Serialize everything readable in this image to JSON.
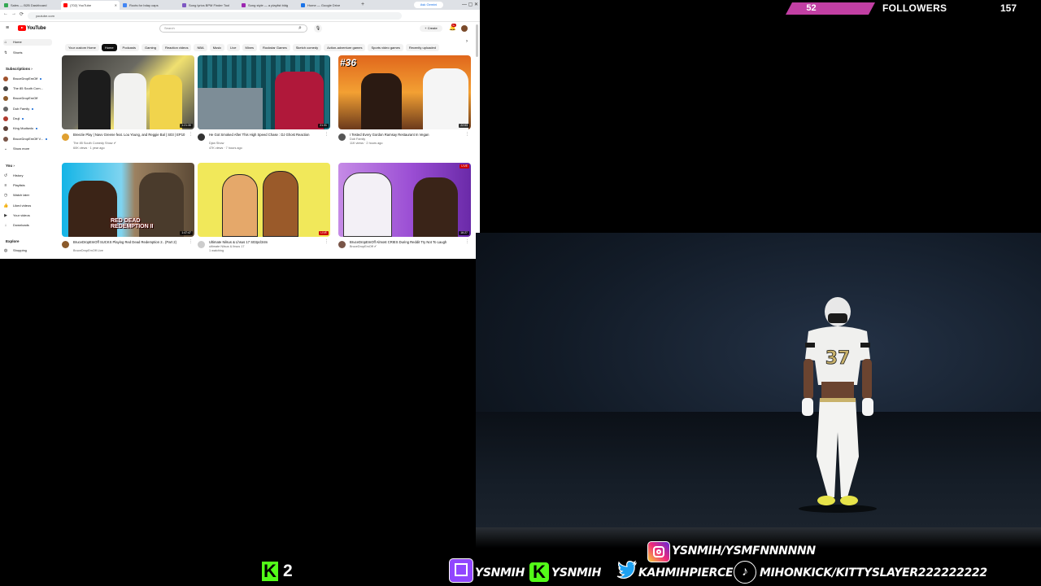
{
  "browser": {
    "tabs": [
      {
        "label": "Sales — B2B Dashboard",
        "color": "#34a853"
      },
      {
        "label": "(702) YouTube",
        "color": "#ff0000"
      },
      {
        "label": "Roots for bday caps",
        "color": "#4285f4"
      },
      {
        "label": "Song lyrics BPM Finder Tool",
        "color": "#7e57c2"
      },
      {
        "label": "Song style — a playlist bldg",
        "color": "#9c27b0"
      },
      {
        "label": "Home — Google Drive",
        "color": "#1a73e8"
      }
    ],
    "new_tab": "+",
    "gemini_label": "Ask Gemini",
    "window_controls": "—  ▢  ✕",
    "url": "youtube.com",
    "nav": {
      "back": "←",
      "forward": "→",
      "reload": "⟳"
    }
  },
  "youtube": {
    "logo_text": "YouTube",
    "search_placeholder": "Search",
    "create_label": "+ Create",
    "notification_count": "9+",
    "sidebar": {
      "main": [
        {
          "label": "Home",
          "icon": "⌂"
        },
        {
          "label": "Shorts",
          "icon": "↯"
        }
      ],
      "subscriptions_title": "Subscriptions ›",
      "subscriptions": [
        {
          "label": "BruceDropEmOff",
          "color": "#a0522d"
        },
        {
          "label": "The 85 South Com...",
          "color": "#444"
        },
        {
          "label": "BruceDropEmOff",
          "color": "#8b5a2b"
        },
        {
          "label": "Dub Family",
          "color": "#666"
        },
        {
          "label": "Druji",
          "color": "#b03a2e"
        },
        {
          "label": "King Mudiwdo",
          "color": "#5d4037"
        },
        {
          "label": "BruceDropEmOff V...",
          "color": "#795548"
        },
        {
          "label": "Show more",
          "color": "#ffffff"
        }
      ],
      "you_title": "You ›",
      "you": [
        {
          "label": "History",
          "icon": "↺"
        },
        {
          "label": "Playlists",
          "icon": "≡"
        },
        {
          "label": "Watch later",
          "icon": "◷"
        },
        {
          "label": "Liked videos",
          "icon": "👍"
        },
        {
          "label": "Your videos",
          "icon": "▶"
        },
        {
          "label": "Downloads",
          "icon": "↓"
        }
      ],
      "explore_title": "Explore",
      "explore": [
        {
          "label": "Shopping",
          "icon": "◍"
        }
      ]
    },
    "chips": [
      "Your custom Home",
      "Home",
      "Podcasts",
      "Gaming",
      "Reaction videos",
      "NBA",
      "Music",
      "Live",
      "Mixes",
      "Rockstar Games",
      "Sketch comedy",
      "Action-adventure games",
      "Sports video games",
      "Recently uploaded"
    ],
    "active_chip": "Home",
    "videos": [
      {
        "title": "Breezie Play | Navv Greene feat. Lou Young, and Reggie Bal | S03 | EP10",
        "channel": "The 85 South Comedy Show ✔",
        "stats": "60K views · 1 year ago",
        "duration": "1:21:30",
        "channel_color": "#e0a030"
      },
      {
        "title": "He Got Smoked After This High Speed Chase : DJ Ghost Reaction",
        "channel": "Djan Show",
        "stats": "47K views · 7 hours ago",
        "duration": "21:31",
        "channel_color": "#333333"
      },
      {
        "title": "I Tested Every Gordon Ramsay Restaurant In Vegan",
        "channel": "Dub Family",
        "stats": "11K views · 2 hours ago",
        "duration": "22:53",
        "channel_color": "#555555",
        "badge": "#36"
      },
      {
        "title": "BruceDropEmOff SUCKS Playing Red Dead Redemption 2.. (Part 2)",
        "channel": "BruceDropEmOff Live",
        "stats": "",
        "duration": "1:47:47",
        "channel_color": "#8b5a2b",
        "overlay": "RED DEAD REDEMPTION II"
      },
      {
        "title": "Ultimate Nilsus & Lhsus 17 S03pcl34m",
        "channel": "ultimate Nilsus & lhsus 17",
        "stats": "1 watching",
        "duration": "LIVE",
        "channel_color": "#cccccc"
      },
      {
        "title": "BruceDropEmOff Almost CRIES During Reddit Try Not To Laugh",
        "channel": "BruceDropEmOff ✔",
        "stats": "",
        "duration": "16:27",
        "channel_color": "#795548",
        "live_badge": "LIVE"
      }
    ]
  },
  "followers": {
    "current": "52",
    "label": "FOLLOWERS",
    "goal": "157",
    "accent_color": "#c13fa3"
  },
  "kick": {
    "icon_letter": "K",
    "count": "2",
    "color": "#53fc18"
  },
  "socials": {
    "instagram": "YSNMIH/YSMFNNNNNN",
    "twitch": "YSNMIH",
    "kick": "YSNMIH",
    "twitter": "KAHMIHPIERCE",
    "tiktok": "MIHONKICK/KITTYSLAYER222222222",
    "colors": {
      "instagram": "#dd2a7b",
      "twitch": "#9146ff",
      "kick": "#53fc18",
      "twitter": "#1da1f2",
      "tiktok": "#000000"
    }
  },
  "game": {
    "jersey_number": "37"
  }
}
